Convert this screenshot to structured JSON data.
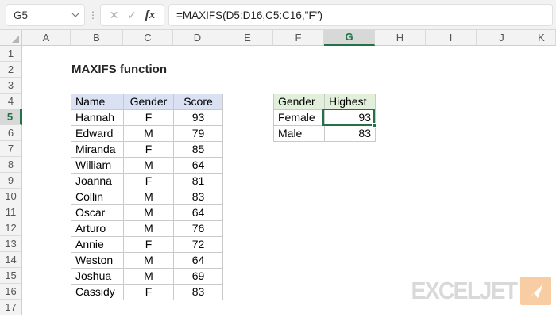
{
  "formula_bar": {
    "cell_reference": "G5",
    "formula": "=MAXIFS(D5:D16,C5:C16,\"F\")",
    "cancel_icon": "✕",
    "enter_icon": "✓",
    "fx_icon": "fx",
    "separator_icon": "⋮"
  },
  "grid": {
    "column_headers": [
      "A",
      "B",
      "C",
      "D",
      "E",
      "F",
      "G",
      "H",
      "I",
      "J",
      "K"
    ],
    "row_headers": [
      "1",
      "2",
      "3",
      "4",
      "5",
      "6",
      "7",
      "8",
      "9",
      "10",
      "11",
      "12",
      "13",
      "14",
      "15",
      "16",
      "17"
    ],
    "selected_column": "G",
    "selected_row": "5"
  },
  "sheet": {
    "title": "MAXIFS function",
    "data_table": {
      "headers": [
        "Name",
        "Gender",
        "Score"
      ],
      "rows": [
        [
          "Hannah",
          "F",
          "93"
        ],
        [
          "Edward",
          "M",
          "79"
        ],
        [
          "Miranda",
          "F",
          "85"
        ],
        [
          "William",
          "M",
          "64"
        ],
        [
          "Joanna",
          "F",
          "81"
        ],
        [
          "Collin",
          "M",
          "83"
        ],
        [
          "Oscar",
          "M",
          "64"
        ],
        [
          "Arturo",
          "M",
          "76"
        ],
        [
          "Annie",
          "F",
          "72"
        ],
        [
          "Weston",
          "M",
          "64"
        ],
        [
          "Joshua",
          "M",
          "69"
        ],
        [
          "Cassidy",
          "F",
          "83"
        ]
      ]
    },
    "result_table": {
      "headers": [
        "Gender",
        "Highest"
      ],
      "rows": [
        [
          "Female",
          "93"
        ],
        [
          "Male",
          "83"
        ]
      ]
    },
    "selected_cell": {
      "reference": "G5",
      "value": "93"
    }
  },
  "logo": {
    "text": "EXCELJET"
  },
  "colors": {
    "accent_green": "#217346",
    "data_table_header_bg": "#D9E1F2",
    "result_table_header_bg": "#E2EFDA",
    "logo_orange": "#F9CDA4"
  }
}
